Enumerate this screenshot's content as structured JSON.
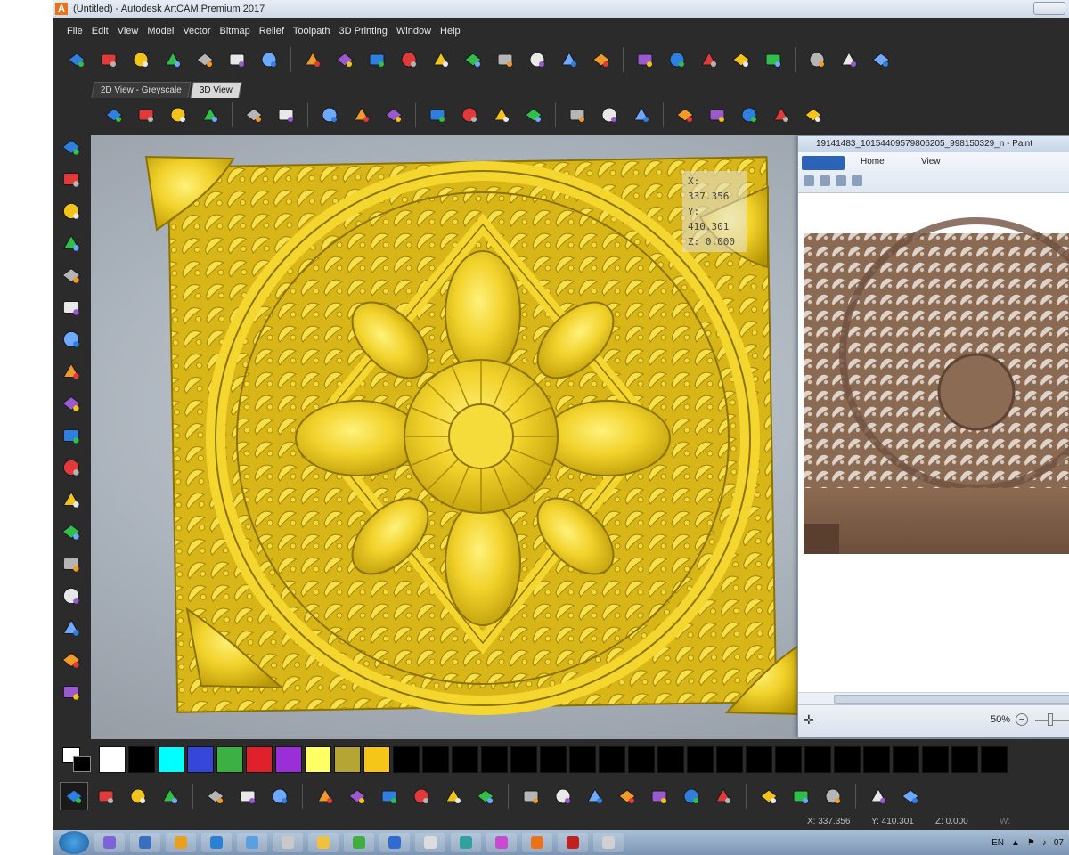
{
  "window": {
    "title": "(Untitled) - Autodesk ArtCAM Premium 2017",
    "logo_letter": "A"
  },
  "menubar": [
    "File",
    "Edit",
    "View",
    "Model",
    "Vector",
    "Bitmap",
    "Relief",
    "Toolpath",
    "3D Printing",
    "Window",
    "Help"
  ],
  "view_tabs": [
    {
      "label": "2D View - Greyscale",
      "active": false
    },
    {
      "label": "3D View",
      "active": true
    }
  ],
  "coords_overlay": {
    "x": "X: 337.356",
    "y": "Y: 410.301",
    "z": "Z: 0.000"
  },
  "paint_window": {
    "title": "19141483_10154409579806205_998150329_n - Paint",
    "tabs": [
      "Home",
      "View"
    ],
    "zoom_label": "50%",
    "zoom_minus": "−",
    "cursor_glyph": "✛"
  },
  "palette": [
    "#ffffff",
    "#000000",
    "#00ffff",
    "#3447d8",
    "#3cb043",
    "#e0202a",
    "#9a2fd8",
    "#ffff66",
    "#b5a535",
    "#f5c518",
    "#000000",
    "#000000",
    "#000000",
    "#000000",
    "#000000",
    "#000000",
    "#000000",
    "#000000",
    "#000000",
    "#000000",
    "#000000",
    "#000000",
    "#000000",
    "#000000",
    "#000000",
    "#000000",
    "#000000",
    "#000000",
    "#000000",
    "#000000",
    "#000000"
  ],
  "statusline": {
    "x": "X: 337.356",
    "y": "Y: 410.301",
    "z": "Z: 0.000",
    "w": "W:"
  },
  "taskbar": {
    "tray_lang": "EN",
    "tray_clock": "07"
  },
  "icons": {
    "toolbar_top": [
      "raise-plane-icon",
      "eraser-relief-icon",
      "shape-editor-icon",
      "extrude-icon",
      "weave-icon",
      "bevel-icon",
      "texture-icon",
      "combine-icon",
      "offset-relief-icon",
      "layer-stack-icon",
      "relief-from-image-icon",
      "smooth-relief-icon",
      "bake-relief-icon",
      "mirror-relief-icon",
      "trim-icon",
      "sculpt-icon",
      "fade-icon",
      "measure-icon",
      "split-icon",
      "grid-icon",
      "flag-icon",
      "eye-icon",
      "node-edit-icon",
      "spline-icon",
      "wave-icon"
    ],
    "toolbar_view": [
      "iso-view-icon",
      "front-view-icon",
      "side-view-icon",
      "top-view-icon",
      "zoom-icon",
      "light-icon",
      "plane-icon",
      "axis-icon",
      "puzzle-icon",
      "cylinder-icon",
      "box-icon",
      "material-icon",
      "reset-view-icon",
      "star-icon",
      "layers-icon",
      "red-layer-icon",
      "yellow-plane-icon",
      "green-shape-icon",
      "magic-zoom-icon",
      "rgb-icon",
      "color-palette-icon"
    ],
    "left_tools": [
      "open-folder-star-icon",
      "vector-arrow-icon",
      "node-tool-icon",
      "curve-tool-icon",
      "green-relief-icon",
      "stack-tool-icon",
      "frame-tool-icon",
      "distort-icon",
      "sculpt-yellow-icon",
      "add-relief-icon",
      "cone-icon",
      "target-icon",
      "mirror-tool-icon",
      "symmetry-icon",
      "dashed-box-icon",
      "mask-icon",
      "loop-icon",
      "triangle-icon"
    ],
    "bottom_tools": [
      "select-arrow-icon",
      "node-select-icon",
      "transform-icon",
      "grid-select-icon",
      "pen-icon",
      "fill-bucket-icon",
      "text-frame-icon",
      "polyline-icon",
      "rectangle-icon",
      "circle-icon",
      "polygon-icon",
      "arc-icon",
      "text-icon",
      "drop-icon",
      "spray-icon",
      "pencil-icon",
      "brush-icon",
      "eraser-icon",
      "paint-bucket-icon",
      "knife-icon",
      "erase-color-icon",
      "link-icon",
      "color-layers-icon",
      "zoom-lens-icon",
      "sphere-icon"
    ]
  }
}
